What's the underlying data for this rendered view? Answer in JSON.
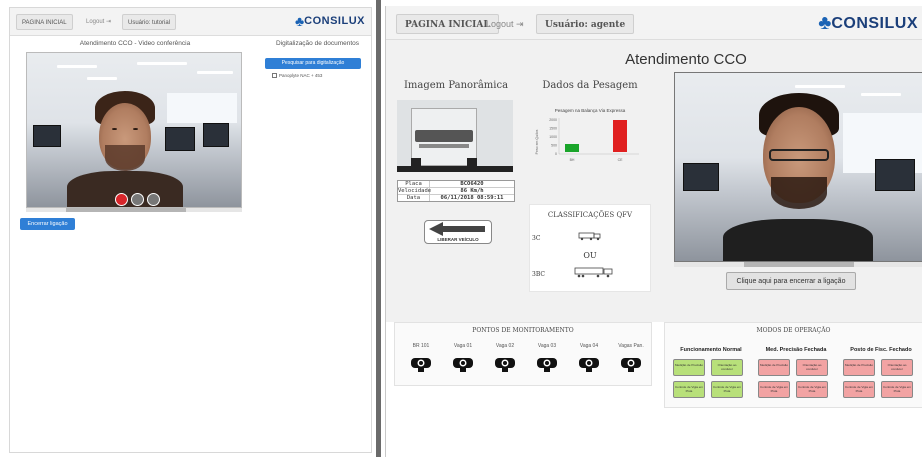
{
  "left": {
    "nav": {
      "home": "PAGINA INICIAL",
      "logout": "Logout",
      "user": "Usuário: tutorial"
    },
    "logo": {
      "name": "CONSILUX",
      "sub": "TECNOLOGIA"
    },
    "video_title": "Atendimento CCO - Video conferência",
    "docs_title": "Digitalização de documentos",
    "scan_button": "Pesquisar para digitalização",
    "checkbox_label": "Panoplyte NAC + 453",
    "end_call": "Encerrar ligação"
  },
  "right": {
    "nav": {
      "home": "PAGINA INICIAL",
      "logout": "Logout",
      "user": "Usuário: agente"
    },
    "logo": {
      "name": "CONSILUX",
      "sub": "TECNOLOGIA"
    },
    "page_title": "Atendimento CCO",
    "panoramic_title": "Imagem Panorâmica",
    "weighing_title": "Dados da Pesagem",
    "weighing_chart": {
      "title": "Pesagem na Balança Via Expressa",
      "ylabel": "Peso em Quilos",
      "yticks": [
        "2000",
        "1500",
        "1000",
        "500",
        "0"
      ],
      "categories": [
        "BH",
        "CE"
      ],
      "colors": [
        "#1aa52a",
        "#e02020"
      ]
    },
    "vehicle": {
      "plate_label": "Placa",
      "plate": "BCO6420",
      "speed_label": "Velocidade",
      "speed": "86 Km/h",
      "date_label": "Data",
      "date": "06/11/2018 08:59:11"
    },
    "release_button": "LIBERAR VEÍCULO",
    "qfv_title": "CLASSIFICAÇÕES QFV",
    "qfv_a": "3C",
    "qfv_or": "OU",
    "qfv_b": "3BC",
    "end_call_button": "Clique aqui para encerrar a ligação",
    "monitoring_title": "PONTOS DE MONITORAMENTO",
    "monitor_points": [
      "BR 101",
      "Vaga 01",
      "Vaga 02",
      "Vaga 03",
      "Vaga 04",
      "Vagas Pan."
    ],
    "modes_title": "MODOS DE OPERAÇÃO",
    "modes": [
      {
        "title": "Funcionamento Normal",
        "color": "#b8e07a",
        "buttons": [
          "Medição de Precisão",
          "Orientação ao condutor",
          "Controle de Vigia em Pista",
          "Controle de Vigia em Pista"
        ]
      },
      {
        "title": "Med. Precisão Fechada",
        "color": "#f2a3a3",
        "buttons": [
          "Medição de Precisão",
          "Orientação ao condutor",
          "Controle de Vigia em Pista",
          "Controle de Vigia em Pista"
        ]
      },
      {
        "title": "Posto de Fisc. Fechado",
        "color": "#f2a3a3",
        "buttons": [
          "Medição de Precisão",
          "Orientação ao condutor",
          "Controle de Vigia em Pista",
          "Controle de Vigia em Pista"
        ]
      }
    ]
  }
}
